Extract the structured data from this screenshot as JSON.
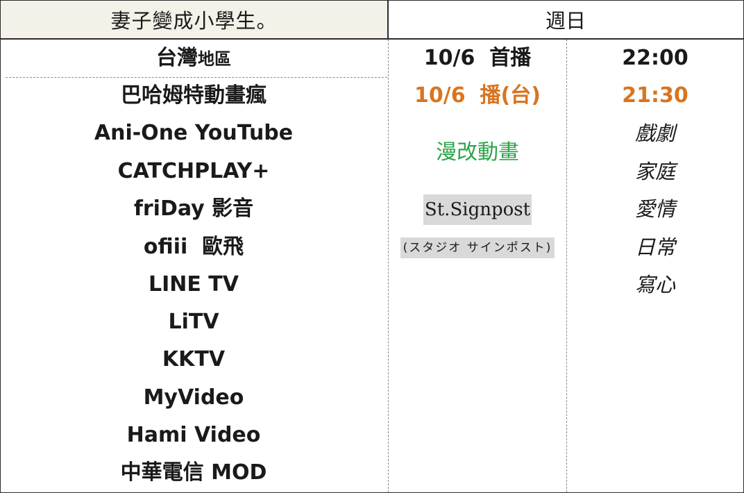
{
  "header": {
    "title": "妻子變成小學生。",
    "day": "週日"
  },
  "region": {
    "main": "台灣",
    "suffix": "地區"
  },
  "schedule": {
    "premiere_label": "10/6  首播",
    "premiere_time": "22:00",
    "tw_air_label": "10/6  播(台)",
    "tw_air_time": "21:30"
  },
  "platforms": [
    "巴哈姆特動畫瘋",
    "Ani-One YouTube",
    "CATCHPLAY+",
    "friDay 影音",
    "ofiii  歐飛",
    "LINE TV",
    "LiTV",
    "KKTV",
    "MyVideo",
    "Hami Video",
    "中華電信 MOD"
  ],
  "info": {
    "origin": "漫改動畫",
    "studio": "St.Signpost",
    "studio_jp": "(スタジオ サインポスト)"
  },
  "genres": [
    "戲劇",
    "家庭",
    "愛情",
    "日常",
    "寫心"
  ],
  "colors": {
    "accent_orange": "#d9741f",
    "accent_green": "#2aa54a",
    "header_bg": "#f3f1e8",
    "studio_bg": "#d9d9d9"
  }
}
